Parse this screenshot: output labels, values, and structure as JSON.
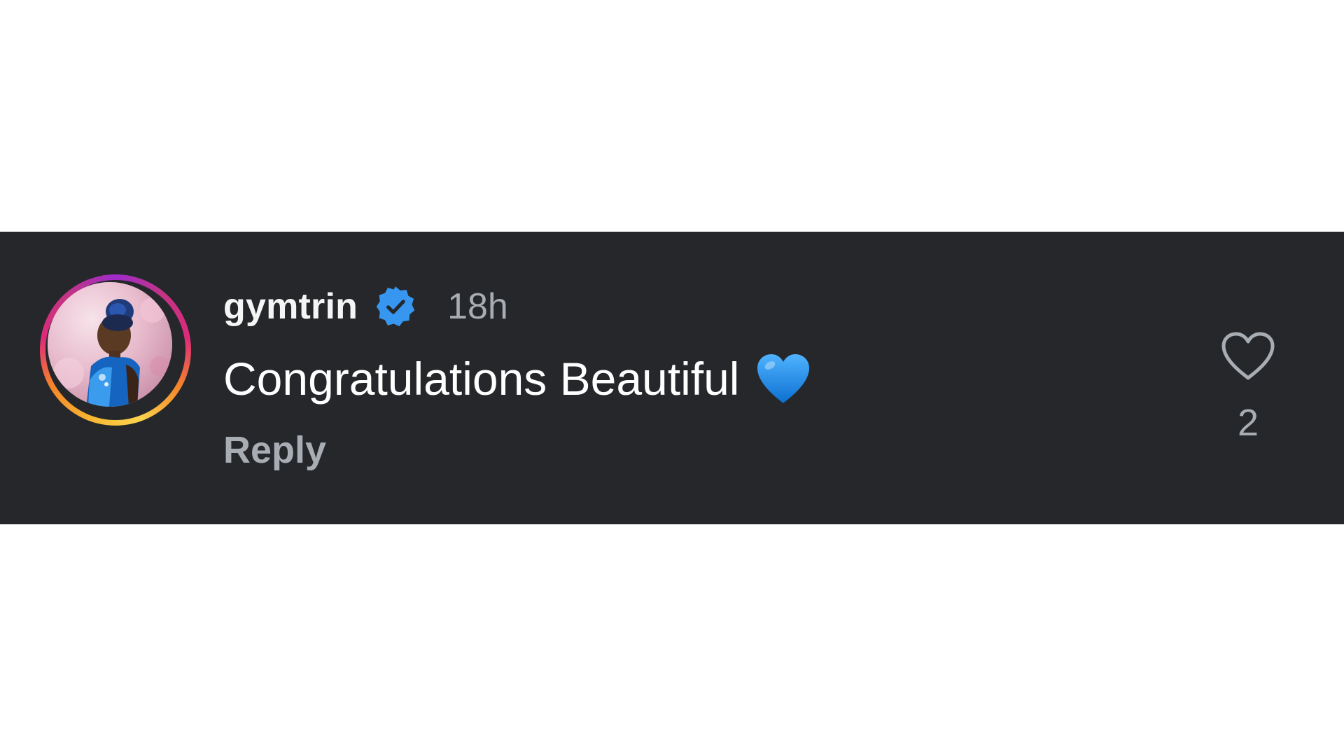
{
  "comment": {
    "username": "gymtrin",
    "verified": true,
    "timestamp": "18h",
    "text": "Congratulations Beautiful",
    "emoji": "blue-heart",
    "reply_label": "Reply",
    "like_count": "2"
  },
  "colors": {
    "card_background": "#25272b",
    "page_background": "#ffffff",
    "verified_badge": "#3797f0",
    "muted_text": "#a8acb3",
    "primary_text": "#ffffff",
    "emoji_heart": "#1e8fe6"
  },
  "icons": {
    "verified": "verified-badge-icon",
    "like": "heart-outline-icon",
    "emoji": "blue-heart-emoji"
  }
}
